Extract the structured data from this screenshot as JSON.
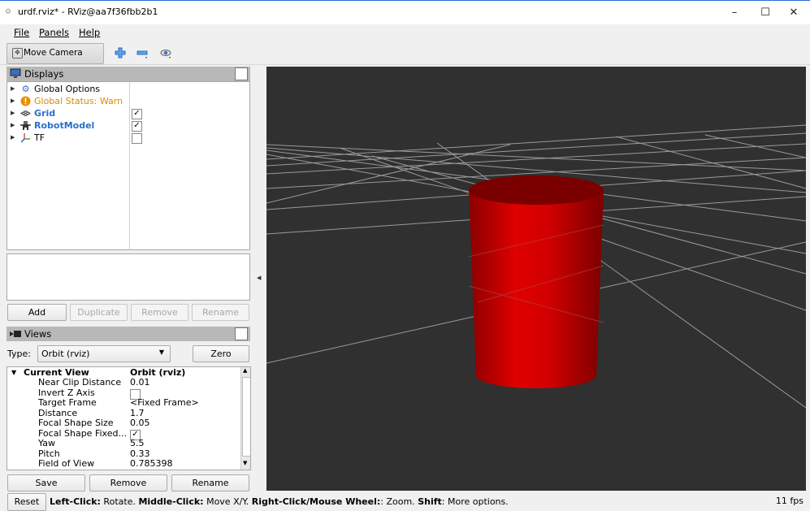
{
  "window": {
    "title": "urdf.rviz* - RViz@aa7f36fbb2b1",
    "minimize": "–",
    "maximize": "☐",
    "close": "✕"
  },
  "menu": {
    "file": "File",
    "panels": "Panels",
    "help": "Help"
  },
  "toolbar": {
    "move_camera": "Move Camera"
  },
  "displays": {
    "title": "Displays",
    "items": [
      {
        "label": "Global Options",
        "icon": "gear-icon",
        "checked": null
      },
      {
        "label": "Global Status: Warn",
        "icon": "warning-icon",
        "checked": null,
        "color": "#d98b00"
      },
      {
        "label": "Grid",
        "icon": "grid-icon",
        "checked": true,
        "color": "#2a6fc9"
      },
      {
        "label": "RobotModel",
        "icon": "robot-icon",
        "checked": true,
        "color": "#2a6fc9"
      },
      {
        "label": "TF",
        "icon": "tf-axes-icon",
        "checked": false
      }
    ],
    "buttons": {
      "add": "Add",
      "duplicate": "Duplicate",
      "remove": "Remove",
      "rename": "Rename"
    }
  },
  "views": {
    "title": "Views",
    "type_label": "Type:",
    "type_value": "Orbit (rviz)",
    "zero": "Zero",
    "current_view": {
      "name": "Current View",
      "value": "Orbit (rviz)"
    },
    "properties": [
      {
        "name": "Near Clip Distance",
        "value": "0.01"
      },
      {
        "name": "Invert Z Axis",
        "value": "",
        "checkbox": false
      },
      {
        "name": "Target Frame",
        "value": "<Fixed Frame>"
      },
      {
        "name": "Distance",
        "value": "1.7"
      },
      {
        "name": "Focal Shape Size",
        "value": "0.05"
      },
      {
        "name": "Focal Shape Fixed...",
        "value": "",
        "checkbox": true
      },
      {
        "name": "Yaw",
        "value": "5.5"
      },
      {
        "name": "Pitch",
        "value": "0.33"
      },
      {
        "name": "Field of View",
        "value": "0.785398"
      }
    ],
    "buttons": {
      "save": "Save",
      "remove": "Remove",
      "rename": "Rename"
    }
  },
  "status": {
    "reset": "Reset",
    "left_click": "Left-Click:",
    "left_click_desc": " Rotate. ",
    "middle_click": "Middle-Click:",
    "middle_click_desc": " Move X/Y. ",
    "right_click": "Right-Click/Mouse Wheel:",
    "right_click_desc": ": Zoom. ",
    "shift": "Shift",
    "shift_desc": ": More options.",
    "fps": "11 fps"
  },
  "colors": {
    "viewport_bg": "#303030",
    "cylinder": "#d00000",
    "grid_line": "#9a9a9a"
  }
}
